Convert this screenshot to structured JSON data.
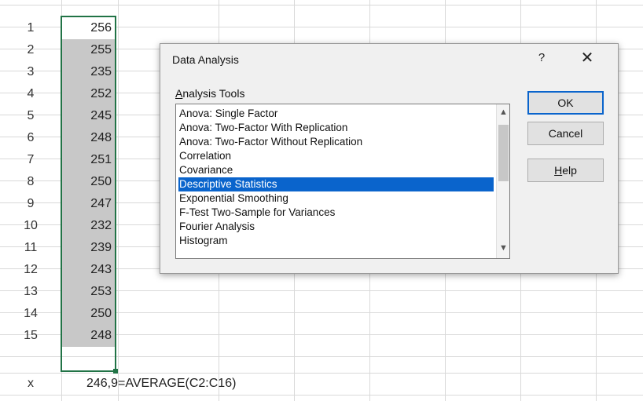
{
  "sheet": {
    "rows": [
      {
        "num": "1",
        "value": "256"
      },
      {
        "num": "2",
        "value": "255"
      },
      {
        "num": "3",
        "value": "235"
      },
      {
        "num": "4",
        "value": "252"
      },
      {
        "num": "5",
        "value": "245"
      },
      {
        "num": "6",
        "value": "248"
      },
      {
        "num": "7",
        "value": "251"
      },
      {
        "num": "8",
        "value": "250"
      },
      {
        "num": "9",
        "value": "247"
      },
      {
        "num": "10",
        "value": "232"
      },
      {
        "num": "11",
        "value": "239"
      },
      {
        "num": "12",
        "value": "243"
      },
      {
        "num": "13",
        "value": "253"
      },
      {
        "num": "14",
        "value": "250"
      },
      {
        "num": "15",
        "value": "248"
      }
    ],
    "summary": {
      "label": "x",
      "value": "246,9",
      "formula": "=AVERAGE(C2:C16)"
    },
    "selection_color": "#217346"
  },
  "dialog": {
    "title": "Data Analysis",
    "help_glyph": "?",
    "close_glyph": "✕",
    "tools_label_access": "A",
    "tools_label_rest": "nalysis Tools",
    "tools": [
      "Anova: Single Factor",
      "Anova: Two-Factor With Replication",
      "Anova: Two-Factor Without Replication",
      "Correlation",
      "Covariance",
      "Descriptive Statistics",
      "Exponential Smoothing",
      "F-Test Two-Sample for Variances",
      "Fourier Analysis",
      "Histogram"
    ],
    "selected_tool": "Descriptive Statistics",
    "ok_label": "OK",
    "cancel_label": "Cancel",
    "help_access": "H",
    "help_rest": "elp",
    "scroll_up_glyph": "▲",
    "scroll_down_glyph": "▼",
    "accent_color": "#0a64cc"
  }
}
